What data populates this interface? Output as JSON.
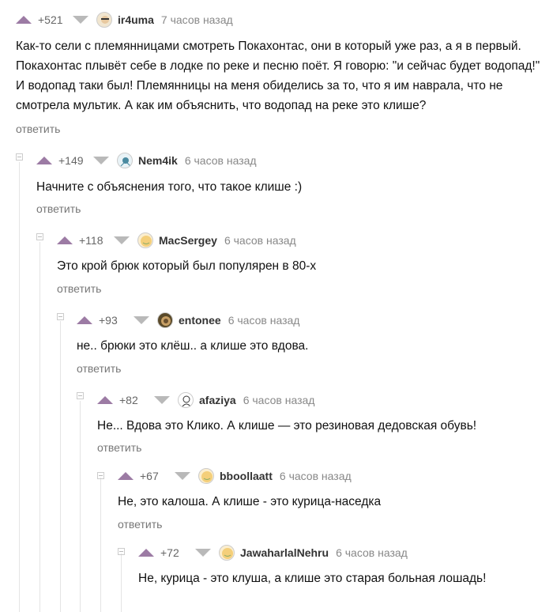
{
  "comments": [
    {
      "rating": "+521",
      "user": "ir4uma",
      "time": "7 часов назад",
      "reply": "ответить",
      "text": "Как-то сели с племянницами смотреть Покахонтас, они в который уже раз, а я в первый. Покахонтас плывёт себе в лодке по реке и песню поёт. Я говорю: \"и сейчас будет водопад!\" И водопад таки был! Племянницы на меня обиделись за то, что я им наврала, что не смотрела мультик. А как им объяснить, что водопад на реке это клише?"
    },
    {
      "rating": "+149",
      "user": "Nem4ik",
      "time": "6 часов назад",
      "reply": "ответить",
      "text": "Начните с объяснения того, что такое клише :)"
    },
    {
      "rating": "+118",
      "user": "MacSergey",
      "time": "6 часов назад",
      "reply": "ответить",
      "text": "Это крой брюк который был популярен в 80-х"
    },
    {
      "rating": "+93",
      "user": "entonee",
      "time": "6 часов назад",
      "reply": "ответить",
      "text": "не.. брюки это клёш.. а клише это вдова."
    },
    {
      "rating": "+82",
      "user": "afaziya",
      "time": "6 часов назад",
      "reply": "ответить",
      "text": "Не... Вдова это Клико. А клише — это резиновая дедовская обувь!"
    },
    {
      "rating": "+67",
      "user": "bboollaatt",
      "time": "6 часов назад",
      "reply": "ответить",
      "text": "Не, это калоша. А клише - это курица-наседка"
    },
    {
      "rating": "+72",
      "user": "JawaharlalNehru",
      "time": "6 часов назад",
      "reply": "",
      "text": "Не, курица - это клуша, а клише это старая больная лошадь!"
    }
  ]
}
